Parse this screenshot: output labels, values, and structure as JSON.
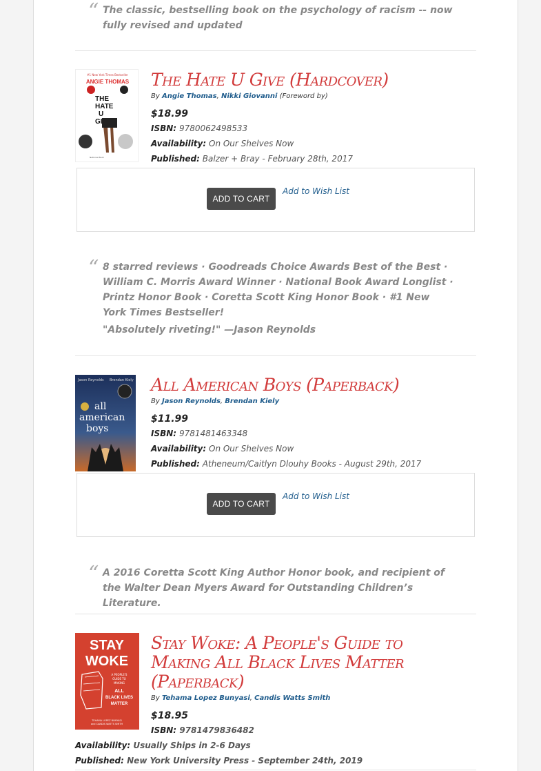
{
  "quote0": {
    "text": "The classic, bestselling book on the psychology of racism -- now fully revised and updated"
  },
  "books": [
    {
      "title": "The Hate U Give (Hardcover)",
      "by_prefix": "By",
      "authors": [
        "Angie Thomas",
        "Nikki Giovanni"
      ],
      "author_suffix": "(Foreword by)",
      "price": "$18.99",
      "isbn_label": "ISBN:",
      "isbn": "9780062498533",
      "availability_label": "Availability:",
      "availability": "On Our Shelves Now",
      "published_label": "Published:",
      "published": "Balzer + Bray - February 28th, 2017",
      "cover_lines": [
        "ANGIE THOMAS",
        "THE",
        "HATE",
        "U",
        "GIVE"
      ],
      "add_to_cart": "ADD TO CART",
      "wish": "Add to Wish List",
      "quote": "8 starred reviews · Goodreads Choice Awards Best of the Best · William C. Morris Award Winner · National Book Award Longlist · Printz Honor Book · Coretta Scott King Honor Book · #1 New York Times Bestseller!",
      "quote2": "\"Absolutely riveting!\" —Jason Reynolds"
    },
    {
      "title": "All American Boys (Paperback)",
      "by_prefix": "By",
      "authors": [
        "Jason Reynolds",
        "Brendan Kiely"
      ],
      "price": "$11.99",
      "isbn_label": "ISBN:",
      "isbn": "9781481463348",
      "availability_label": "Availability:",
      "availability": "On Our Shelves Now",
      "published_label": "Published:",
      "published": "Atheneum/Caitlyn Dlouhy Books - August 29th, 2017",
      "cover_lines": [
        "Jason Reynolds",
        "Brendan Kiely",
        "all",
        "american",
        "boys"
      ],
      "add_to_cart": "ADD TO CART",
      "wish": "Add to Wish List",
      "quote": "A 2016 Coretta Scott King Author Honor book, and recipient of the Walter Dean Myers Award for Outstanding Children’s Literature."
    },
    {
      "title": "Stay Woke: A People's Guide to Making All Black Lives Matter (Paperback)",
      "by_prefix": "By",
      "authors": [
        "Tehama Lopez Bunyasi",
        "Candis Watts Smith"
      ],
      "price": "$18.95",
      "isbn_label": "ISBN:",
      "isbn": "9781479836482",
      "availability_label": "Availability:",
      "availability": "Usually Ships in 2-6 Days",
      "published_label": "Published:",
      "published": "New York University Press - September 24th, 2019",
      "cover_lines": [
        "STAY",
        "WOKE",
        "A PEOPLE'S GUIDE TO MAKING",
        "ALL BLACK LIVES MATTER",
        "TEHAMA LOPEZ BUNYASI and CANDIS WATTS SMITH"
      ]
    }
  ]
}
